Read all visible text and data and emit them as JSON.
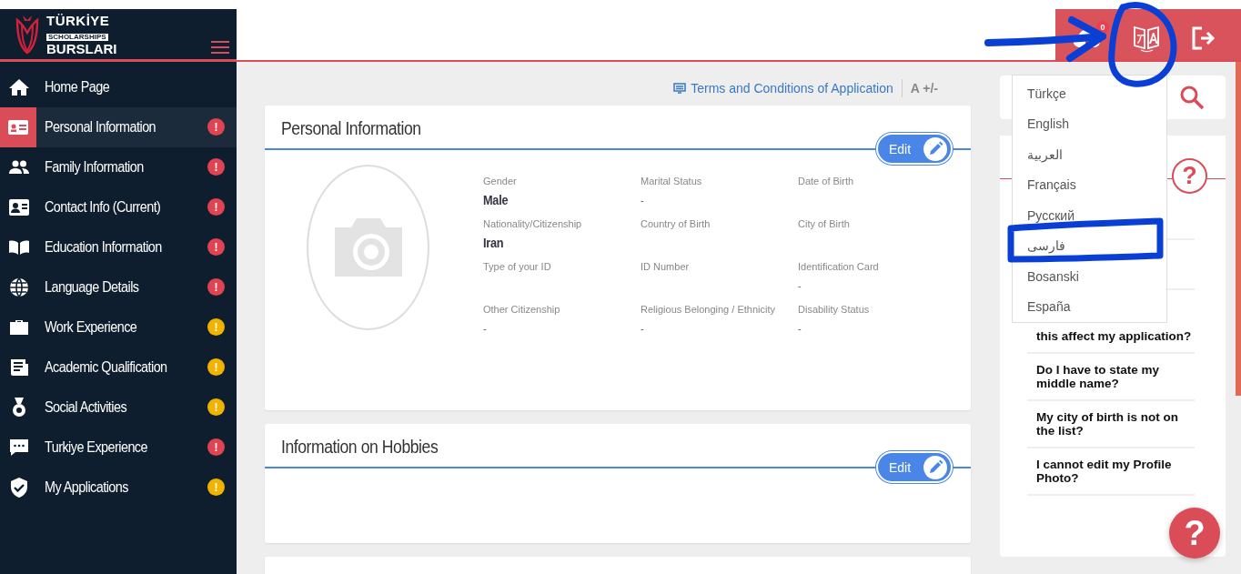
{
  "brand": {
    "line1": "TÜRKİYE",
    "line2": "SCHOLARSHIPS",
    "line3": "BURSLARI"
  },
  "header": {
    "upload_badge": "0"
  },
  "sidebar": {
    "items": [
      {
        "label": "Home Page",
        "selected": false
      },
      {
        "label": "Personal Information",
        "selected": true,
        "badge": "!",
        "color": "#e04452"
      },
      {
        "label": "Family Information",
        "selected": false,
        "badge": "!",
        "color": "#e04452"
      },
      {
        "label": "Contact Info (Current)",
        "selected": false,
        "badge": "!",
        "color": "#e04452"
      },
      {
        "label": "Education Information",
        "selected": false,
        "badge": "!",
        "color": "#e04452"
      },
      {
        "label": "Language Details",
        "selected": false,
        "badge": "!",
        "color": "#e04452"
      },
      {
        "label": "Work Experience",
        "selected": false,
        "badge": "!",
        "color": "#f0b400"
      },
      {
        "label": "Academic Qualification",
        "selected": false,
        "badge": "!",
        "color": "#f0b400"
      },
      {
        "label": "Social Activities",
        "selected": false,
        "badge": "!",
        "color": "#f0b400"
      },
      {
        "label": "Turkiye Experience",
        "selected": false,
        "badge": "!",
        "color": "#e04452"
      },
      {
        "label": "My Applications",
        "selected": false,
        "badge": "!",
        "color": "#f0b400"
      }
    ]
  },
  "toolbar": {
    "terms_link": "Terms and Conditions of Application",
    "font_size": "A +/-"
  },
  "cards": [
    {
      "title": "Personal Information",
      "edit": "Edit",
      "fields": [
        {
          "label": "Gender",
          "value": "Male",
          "kind": "filled"
        },
        {
          "label": "Marital Status",
          "value": "-",
          "kind": "empty"
        },
        {
          "label": "Date of Birth"
        },
        {
          "label": "Nationality/Citizenship",
          "value": "Iran",
          "kind": "filled"
        },
        {
          "label": "Country of Birth"
        },
        {
          "label": "City of Birth"
        },
        {
          "label": "Type of your ID"
        },
        {
          "label": "ID Number"
        },
        {
          "label": "Identification Card",
          "value": "-",
          "kind": "empty"
        },
        {
          "label": "Other Citizenship",
          "value": "-",
          "kind": "empty"
        },
        {
          "label": "Religious Belonging / Ethnicity",
          "value": "-",
          "kind": "empty"
        },
        {
          "label": "Disability Status",
          "value": "-",
          "kind": "empty"
        }
      ]
    },
    {
      "title": "Information on Hobbies",
      "edit": "Edit"
    }
  ],
  "faq": {
    "help_mark": "?",
    "items": [
      "this affect my application?",
      "Do I have to state my middle name?",
      "My city of birth is not on the list?",
      "I cannot edit my Profile Photo?"
    ]
  },
  "language_menu": {
    "items": [
      "Türkçe",
      "English",
      "العربية",
      "Français",
      "Русский",
      "فارسی",
      "Bosanski",
      "España"
    ]
  },
  "help_button": "?"
}
